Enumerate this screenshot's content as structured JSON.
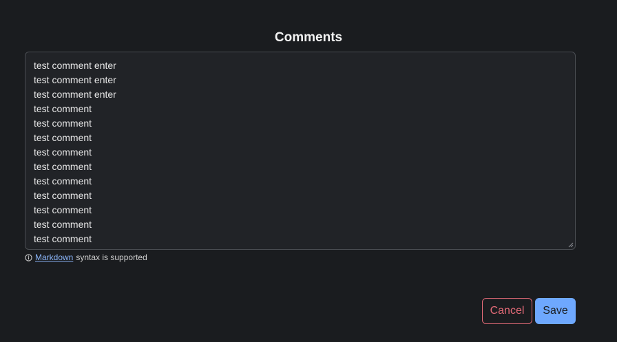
{
  "section": {
    "title": "Comments"
  },
  "comment": {
    "lines": [
      "test comment enter",
      "test comment enter",
      "test comment enter",
      "test comment",
      "test comment",
      "test comment",
      "test comment",
      "test comment",
      "test comment",
      "test comment",
      "test comment",
      "test comment",
      "test comment"
    ]
  },
  "hint": {
    "link_text": "Markdown",
    "suffix_text": "syntax is supported",
    "icon": "info-circle-icon"
  },
  "actions": {
    "cancel_label": "Cancel",
    "save_label": "Save"
  },
  "colors": {
    "background": "#1a1c1f",
    "textarea_bg": "#212327",
    "cancel": "#e46b78",
    "save": "#6ea8fe",
    "link": "#8ab4f8"
  }
}
